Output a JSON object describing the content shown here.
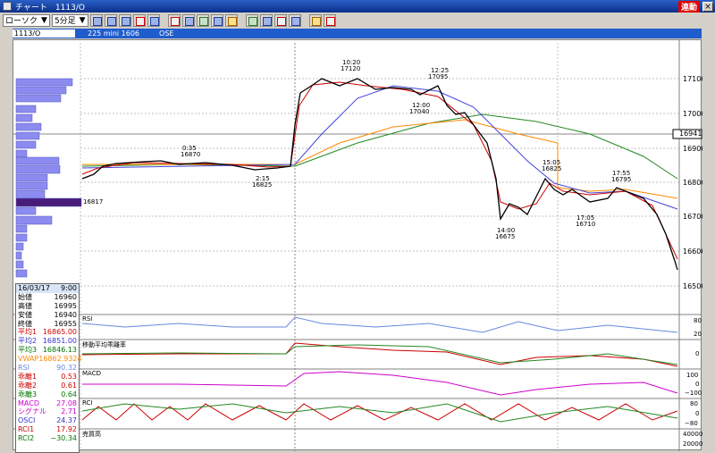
{
  "window": {
    "title": "チャート　1113/O",
    "live_badge": "連動",
    "close": "×"
  },
  "toolbar": {
    "chart_type": "ローソク",
    "interval": "5分足"
  },
  "infobar": {
    "symbol": "1113/O",
    "name": "225 mini 1606",
    "exchange": "OSE"
  },
  "price_axis": {
    "ticks": [
      "17100",
      "17000",
      "16900",
      "16800",
      "16700",
      "16600",
      "16500"
    ],
    "current": "16941"
  },
  "annotations": {
    "a1": {
      "time": "0:35",
      "price": "16870"
    },
    "a2": {
      "time": "2:15",
      "price": "16825"
    },
    "a3": {
      "time": "10:20",
      "price": "17120"
    },
    "a4": {
      "time": "12:25",
      "price": "17095"
    },
    "a5": {
      "time": "12:00",
      "price": "17040"
    },
    "a6": {
      "time": "14:00",
      "price": "16675"
    },
    "a7": {
      "time": "15:05",
      "price": "16825"
    },
    "a8": {
      "time": "17:05",
      "price": "16710"
    },
    "a9": {
      "time": "17:55",
      "price": "16795"
    },
    "vp": "16817"
  },
  "panes": {
    "rsi": {
      "label": "RSI",
      "ticks": [
        "80",
        "20"
      ]
    },
    "kairi": {
      "label": "移動平均乖離率",
      "ticks": [
        "0"
      ]
    },
    "macd": {
      "label": "MACD",
      "ticks": [
        "100",
        "0",
        "−100"
      ]
    },
    "rci": {
      "label": "RCI",
      "ticks": [
        "80",
        "0",
        "−80"
      ]
    },
    "volume": {
      "label": "売買高",
      "ticks": [
        "40000",
        "20000"
      ]
    }
  },
  "ohlc": {
    "date": "16/03/17",
    "time": "9:00",
    "rows": [
      {
        "label": "始値",
        "value": "16960",
        "color": "#000000"
      },
      {
        "label": "高値",
        "value": "16995",
        "color": "#000000"
      },
      {
        "label": "安値",
        "value": "16940",
        "color": "#000000"
      },
      {
        "label": "終値",
        "value": "16955",
        "color": "#000000"
      },
      {
        "label": "平均1",
        "value": "16865.00",
        "color": "#cc0000"
      },
      {
        "label": "平均2",
        "value": "16851.00",
        "color": "#3333cc"
      },
      {
        "label": "平均3",
        "value": "16846.13",
        "color": "#007700"
      },
      {
        "label": "VWAP",
        "value": "16862.9324",
        "color": "#ff8800"
      },
      {
        "label": "RSI",
        "value": "90.32",
        "color": "#6688dd"
      },
      {
        "label": "乖離1",
        "value": "0.53",
        "color": "#cc0000"
      },
      {
        "label": "乖離2",
        "value": "0.61",
        "color": "#cc0000"
      },
      {
        "label": "乖離3",
        "value": "0.64",
        "color": "#007700"
      },
      {
        "label": "MACD",
        "value": "27.08",
        "color": "#cc00cc"
      },
      {
        "label": "シグナル",
        "value": "2.71",
        "color": "#cc00cc"
      },
      {
        "label": "OSCI",
        "value": "24.37",
        "color": "#3333cc"
      },
      {
        "label": "RCI1",
        "value": "17.92",
        "color": "#cc0000"
      },
      {
        "label": "RCI2",
        "value": "−30.34",
        "color": "#007700"
      }
    ]
  }
}
